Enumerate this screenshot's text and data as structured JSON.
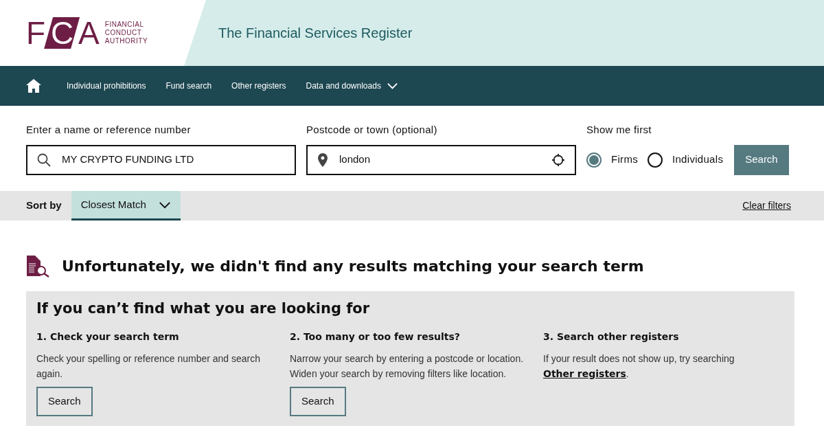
{
  "logo": {
    "letters": [
      "F",
      "C",
      "A"
    ],
    "name_lines": [
      "FINANCIAL",
      "CONDUCT",
      "AUTHORITY"
    ]
  },
  "header": {
    "title": "The Financial Services Register"
  },
  "nav": {
    "items": [
      {
        "label": "Individual prohibitions",
        "dropdown": false
      },
      {
        "label": "Fund search",
        "dropdown": false
      },
      {
        "label": "Other registers",
        "dropdown": false
      },
      {
        "label": "Data and downloads",
        "dropdown": true
      }
    ]
  },
  "search": {
    "name_label": "Enter a name or reference number",
    "name_value": "MY CRYPTO FUNDING LTD",
    "location_label": "Postcode or town (optional)",
    "location_value": "london",
    "show_label": "Show me first",
    "options": [
      {
        "label": "Firms",
        "selected": true
      },
      {
        "label": "Individuals",
        "selected": false
      }
    ],
    "button": "Search"
  },
  "sort": {
    "label": "Sort by",
    "value": "Closest Match",
    "clear": "Clear filters"
  },
  "result": {
    "message": "Unfortunately, we didn't find any results matching your search term"
  },
  "help": {
    "title": "If you can’t find what you are looking for",
    "columns": [
      {
        "heading": "1. Check your search term",
        "text": "Check your spelling or reference number and search again.",
        "button": "Search"
      },
      {
        "heading": "2. Too many or too few results?",
        "text": "Narrow your search by entering a postcode or location. Widen your search by removing filters like location.",
        "button": "Search"
      },
      {
        "heading": "3. Search other registers",
        "text_before": "If your result does not show up, try searching ",
        "link": "Other registers",
        "text_after": "."
      }
    ]
  }
}
